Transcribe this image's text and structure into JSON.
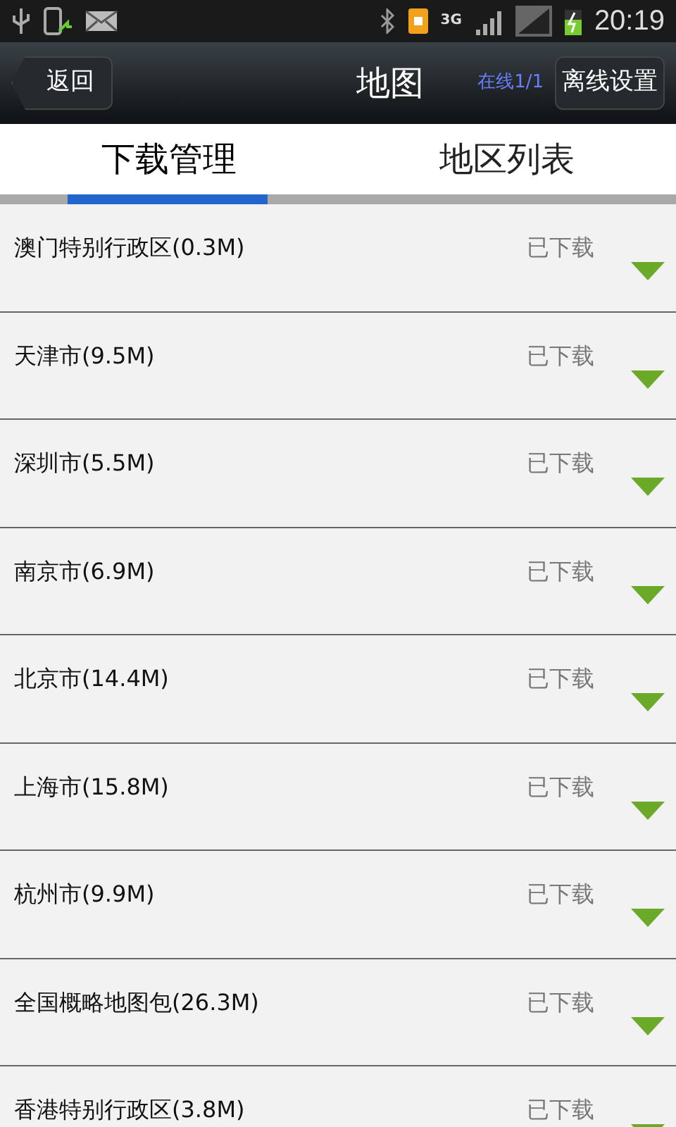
{
  "status_bar": {
    "network": "3G",
    "time": "20:19"
  },
  "header": {
    "back": "返回",
    "title": "地图",
    "progress": "在线1/1",
    "settings": "离线设置"
  },
  "tabs": [
    {
      "label": "下载管理",
      "selected": true
    },
    {
      "label": "地区列表",
      "selected": false
    }
  ],
  "items": [
    {
      "name": "澳门特别行政区(0.3M)",
      "status": "已下载"
    },
    {
      "name": "天津市(9.5M)",
      "status": "已下载"
    },
    {
      "name": "深圳市(5.5M)",
      "status": "已下载"
    },
    {
      "name": "南京市(6.9M)",
      "status": "已下载"
    },
    {
      "name": "北京市(14.4M)",
      "status": "已下载"
    },
    {
      "name": "上海市(15.8M)",
      "status": "已下载"
    },
    {
      "name": "杭州市(9.9M)",
      "status": "已下载"
    },
    {
      "name": "全国概略地图包(26.3M)",
      "status": "已下载"
    },
    {
      "name": "香港特别行政区(3.8M)",
      "status": "已下载"
    }
  ]
}
